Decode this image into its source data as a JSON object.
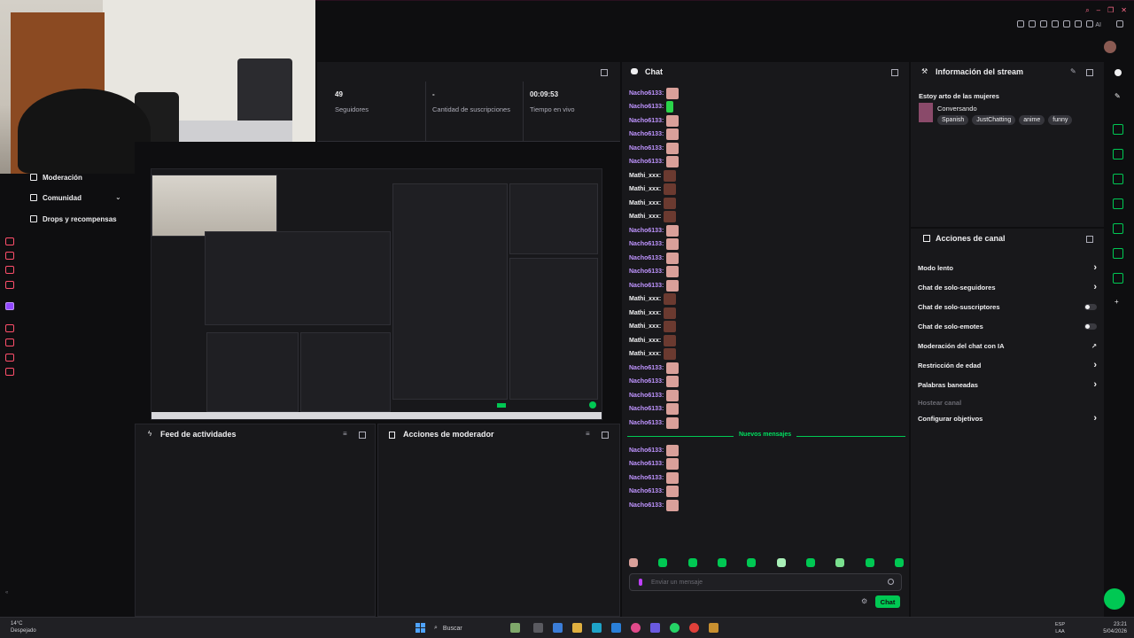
{
  "stats": {
    "followers_value": "49",
    "followers_label": "Seguidores",
    "subs_value": "-",
    "subs_label": "Cantidad de suscripciones",
    "live_value": "00:09:53",
    "live_label": "Tiempo en vivo"
  },
  "nav": {
    "items": [
      {
        "label": "Moderación"
      },
      {
        "label": "Comunidad"
      },
      {
        "label": "Drops y recompensas"
      }
    ]
  },
  "panels": {
    "feed_title": "Feed de actividades",
    "mod_title": "Acciones de moderador"
  },
  "chat": {
    "title": "Chat",
    "messages": [
      {
        "user": "Nacho6133:"
      },
      {
        "user": "Nacho6133:"
      },
      {
        "user": "Nacho6133:"
      },
      {
        "user": "Nacho6133:"
      },
      {
        "user": "Nacho6133:"
      },
      {
        "user": "Nacho6133:"
      },
      {
        "user": "Mathi_xxx:"
      },
      {
        "user": "Mathi_xxx:"
      },
      {
        "user": "Mathi_xxx:"
      },
      {
        "user": "Mathi_xxx:"
      },
      {
        "user": "Nacho6133:"
      },
      {
        "user": "Nacho6133:"
      },
      {
        "user": "Nacho6133:"
      },
      {
        "user": "Nacho6133:"
      },
      {
        "user": "Nacho6133:"
      },
      {
        "user": "Mathi_xxx:"
      },
      {
        "user": "Mathi_xxx:"
      },
      {
        "user": "Mathi_xxx:"
      },
      {
        "user": "Mathi_xxx:"
      },
      {
        "user": "Mathi_xxx:"
      },
      {
        "user": "Nacho6133:"
      },
      {
        "user": "Nacho6133:"
      },
      {
        "user": "Nacho6133:"
      },
      {
        "user": "Nacho6133:"
      },
      {
        "user": "Nacho6133:"
      }
    ],
    "new_messages_label": "Nuevos mensajes",
    "new_messages": [
      {
        "user": "Nacho6133:"
      },
      {
        "user": "Nacho6133:"
      },
      {
        "user": "Nacho6133:"
      },
      {
        "user": "Nacho6133:"
      },
      {
        "user": "Nacho6133:"
      }
    ],
    "input_placeholder": "Enviar un mensaje",
    "send_label": "Chat"
  },
  "stream_info": {
    "title": "Información del stream",
    "stream_title": "Estoy arto de las mujeres",
    "category": "Conversando",
    "tags": [
      "Spanish",
      "JustChatting",
      "anime",
      "funny"
    ]
  },
  "channel_actions": {
    "title": "Acciones de canal",
    "items": [
      {
        "label": "Modo lento",
        "control": "chevron"
      },
      {
        "label": "Chat de solo-seguidores",
        "control": "chevron"
      },
      {
        "label": "Chat de solo-suscriptores",
        "control": "toggle"
      },
      {
        "label": "Chat de solo-emotes",
        "control": "toggle"
      },
      {
        "label": "Moderación del chat con IA",
        "control": "external"
      },
      {
        "label": "Restricción de edad",
        "control": "chevron"
      },
      {
        "label": "Palabras baneadas",
        "control": "chevron"
      },
      {
        "label": "Hostear canal",
        "control": "none"
      },
      {
        "label": "Configurar objetivos",
        "control": "chevron"
      }
    ]
  },
  "taskbar": {
    "weather_temp": "14°C",
    "weather_desc": "Despejado",
    "search_label": "Buscar",
    "lang_top": "ESP",
    "lang_bottom": "LAA",
    "time": "23:21",
    "date": "5/04/2026"
  },
  "topbar": {
    "ai_label": "AI"
  },
  "colors": {
    "accent_green": "#00c853",
    "username_purple": "#bf94ff",
    "panel_bg": "#18181b",
    "page_bg": "#0e0e10"
  }
}
